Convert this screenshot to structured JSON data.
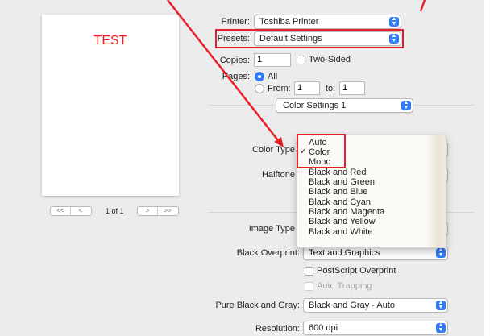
{
  "preview": {
    "doc_text": "TEST",
    "page_indicator": "1 of 1",
    "nav_first": "<<",
    "nav_prev": "<",
    "nav_next": ">",
    "nav_last": ">>"
  },
  "printer": {
    "label": "Printer:",
    "value": "Toshiba Printer"
  },
  "presets": {
    "label": "Presets:",
    "value": "Default Settings"
  },
  "copies": {
    "label": "Copies:",
    "value": "1",
    "two_sided": "Two-Sided"
  },
  "pages": {
    "label": "Pages:",
    "all": "All",
    "from_label": "From:",
    "from_value": "1",
    "to_label": "to:",
    "to_value": "1"
  },
  "panel": {
    "value": "Color Settings 1"
  },
  "color_type": {
    "label": "Color Type"
  },
  "halftone": {
    "label": "Halftone"
  },
  "image_type": {
    "label": "Image Type"
  },
  "color_menu": {
    "items": [
      "Auto",
      "Color",
      "Mono",
      "Black and Red",
      "Black and Green",
      "Black and Blue",
      "Black and Cyan",
      "Black and Magenta",
      "Black and Yellow",
      "Black and White"
    ],
    "checked": "✓"
  },
  "black_overprint": {
    "label": "Black Overprint:",
    "value": "Text and Graphics"
  },
  "postscript_overprint": {
    "label": "PostScript Overprint"
  },
  "auto_trapping": {
    "label": "Auto Trapping"
  },
  "pure_black": {
    "label": "Pure Black and Gray:",
    "value": "Black and Gray - Auto"
  },
  "resolution": {
    "label": "Resolution:",
    "value": "600 dpi"
  },
  "colors": {
    "accent": "#2f7cf6",
    "annotation": "#e8202a",
    "doc_text": "#e8221b"
  }
}
